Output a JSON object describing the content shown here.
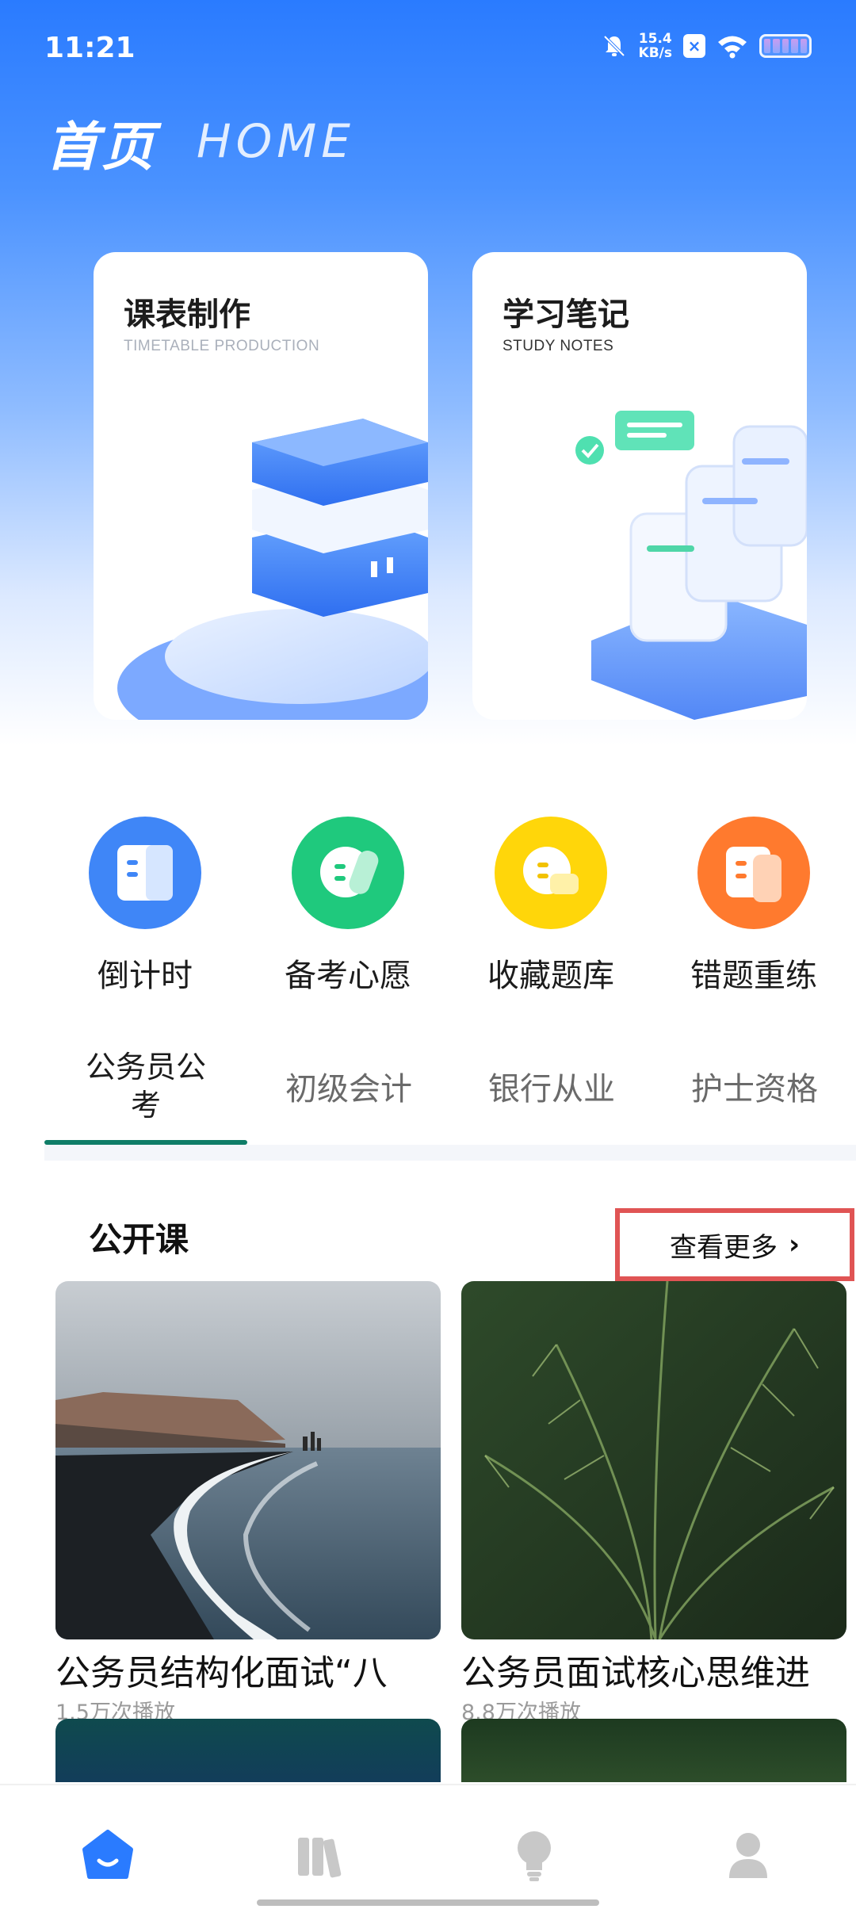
{
  "status_bar": {
    "time": "11:21",
    "speed_value": "15.4",
    "speed_unit": "KB/s",
    "x_icon_text": "×"
  },
  "header": {
    "title_cn": "首页",
    "title_en": "HOME"
  },
  "feature_cards": [
    {
      "title": "课表制作",
      "subtitle": "TIMETABLE PRODUCTION"
    },
    {
      "title": "学习笔记",
      "subtitle": "STUDY NOTES"
    }
  ],
  "quick_actions": [
    {
      "label": "倒计时",
      "color": "#3f86f7"
    },
    {
      "label": "备考心愿",
      "color": "#1fc97d"
    },
    {
      "label": "收藏题库",
      "color": "#ffd60a"
    },
    {
      "label": "错题重练",
      "color": "#ff7a2e"
    }
  ],
  "category_tabs": [
    {
      "label_line1": "公务员公",
      "label_line2": "考"
    },
    {
      "label": "初级会计"
    },
    {
      "label": "银行从业"
    },
    {
      "label": "护士资格"
    }
  ],
  "open_course": {
    "section_title": "公开课",
    "more_label": "查看更多",
    "more_chevron": "›",
    "courses": [
      {
        "title": "公务员结构化面试“八",
        "plays": "1.5万次播放"
      },
      {
        "title": "公务员面试核心思维进",
        "plays": "8.8万次播放"
      }
    ]
  },
  "bottom_nav": [
    "home-icon",
    "books-icon",
    "lightbulb-icon",
    "profile-icon"
  ],
  "colors": {
    "accent": "#2a7bff",
    "tab_underline": "#0f7d67",
    "highlight_box": "#e05454"
  }
}
